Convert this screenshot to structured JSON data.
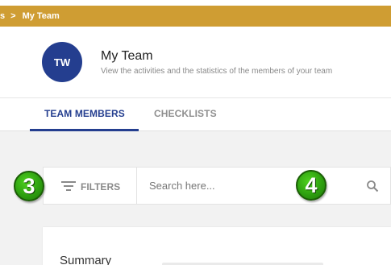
{
  "breadcrumb": {
    "parent_label": "s",
    "separator": ">",
    "current_label": "My Team"
  },
  "header": {
    "avatar_initials": "TW",
    "title": "My Team",
    "subtitle": "View the activities and the statistics of the members of your team"
  },
  "tabs": [
    {
      "label": "TEAM MEMBERS",
      "active": true
    },
    {
      "label": "CHECKLISTS",
      "active": false
    }
  ],
  "filters": {
    "label": "FILTERS",
    "icon": "filter-lines-icon"
  },
  "search": {
    "placeholder": "Search here...",
    "value": "",
    "icon": "search-icon"
  },
  "step_badges": [
    "3",
    "4"
  ],
  "summary": {
    "title": "Summary"
  },
  "colors": {
    "brand_gold": "#cf9d33",
    "brand_navy": "#243e8f",
    "badge_green": "#2ea010"
  }
}
